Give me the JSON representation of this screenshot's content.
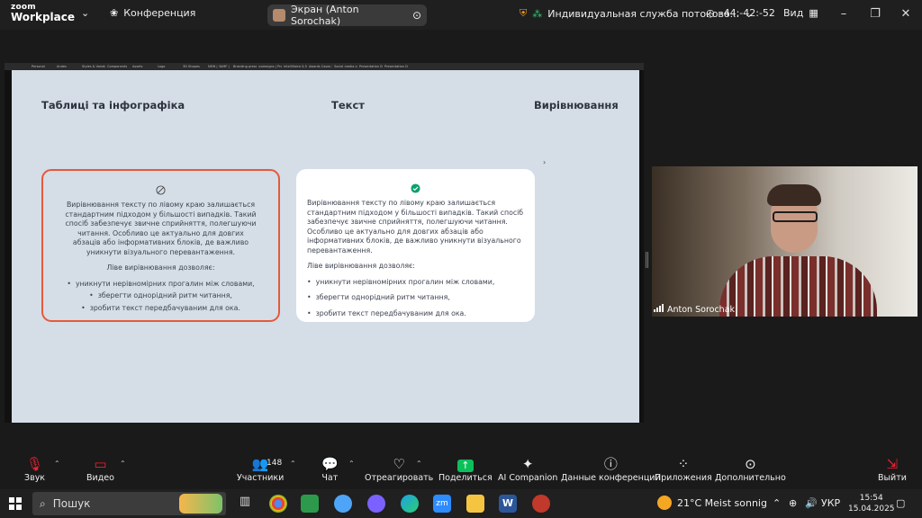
{
  "topbar": {
    "logo_line1": "zoom",
    "logo_line2": "Workplace",
    "meeting_name": "Конференция",
    "share_label": "Экран (Anton Sorochak)",
    "recording_label": "Индивидуальная служба потоково...",
    "timer": "-44:-42:-52",
    "view_label": "Вид"
  },
  "browser_tabs": [
    "Personal",
    "Andes",
    "Styles & Variables",
    "Components",
    "Assets",
    "Logo",
    "3D Shapes",
    "NEW | 3AMF |",
    "Branding presentation",
    "uxdesigns | Profiles",
    "IntelliVoice & Master",
    "Awards Cases 2024",
    "Social media covers",
    "Presentation Design",
    "Presentation Des"
  ],
  "slide": {
    "heading_left": "Таблиці та інфографіка",
    "heading_center": "Текст",
    "heading_right": "Вирівнювання",
    "card_bad": {
      "paragraph": "Вирівнювання тексту по лівому краю залишається стандартним підходом у більшості випадків. Такий спосіб забезпечує звичне сприйняття, полегшуючи читання. Особливо це актуально для довгих абзаців або інформативних блоків, де важливо уникнути візуального перевантаження.",
      "subheading": "Ліве вирівнювання дозволяє:",
      "items": [
        "уникнути нерівномірних прогалин між словами,",
        "зберегти однорідний ритм читання,",
        "зробити текст передбачуваним для ока."
      ]
    },
    "card_good": {
      "paragraph": "Вирівнювання тексту по лівому краю залишається стандартним підходом у більшості випадків. Такий спосіб забезпечує звичне сприйняття, полегшуючи читання. Особливо це актуально для довгих абзаців або інформативних блоків, де важливо уникнути візуального перевантаження.",
      "subheading": "Ліве вирівнювання дозволяє:",
      "items": [
        "уникнути нерівномірних прогалин між словами,",
        "зберегти однорідний ритм читання,",
        "зробити текст передбачуваним для ока."
      ]
    }
  },
  "video": {
    "participant_name": "Anton Sorochak"
  },
  "toolbar": {
    "audio": "Звук",
    "video": "Видео",
    "participants": "Участники",
    "participants_count": "148",
    "chat": "Чат",
    "react": "Отреагировать",
    "share": "Поделиться",
    "ai": "AI Companion",
    "info": "Данные конференции",
    "apps": "Приложения",
    "more": "Дополнительно",
    "leave": "Выйти"
  },
  "taskbar": {
    "search_placeholder": "Пошук",
    "weather": "21°C  Meist sonnig",
    "lang": "УКР",
    "time": "15:54",
    "date": "15.04.2025"
  },
  "colors": {
    "accent_green": "#0e9f6e",
    "warning_red": "#e45a3c",
    "zoom_share_green": "#0dbf5b"
  }
}
